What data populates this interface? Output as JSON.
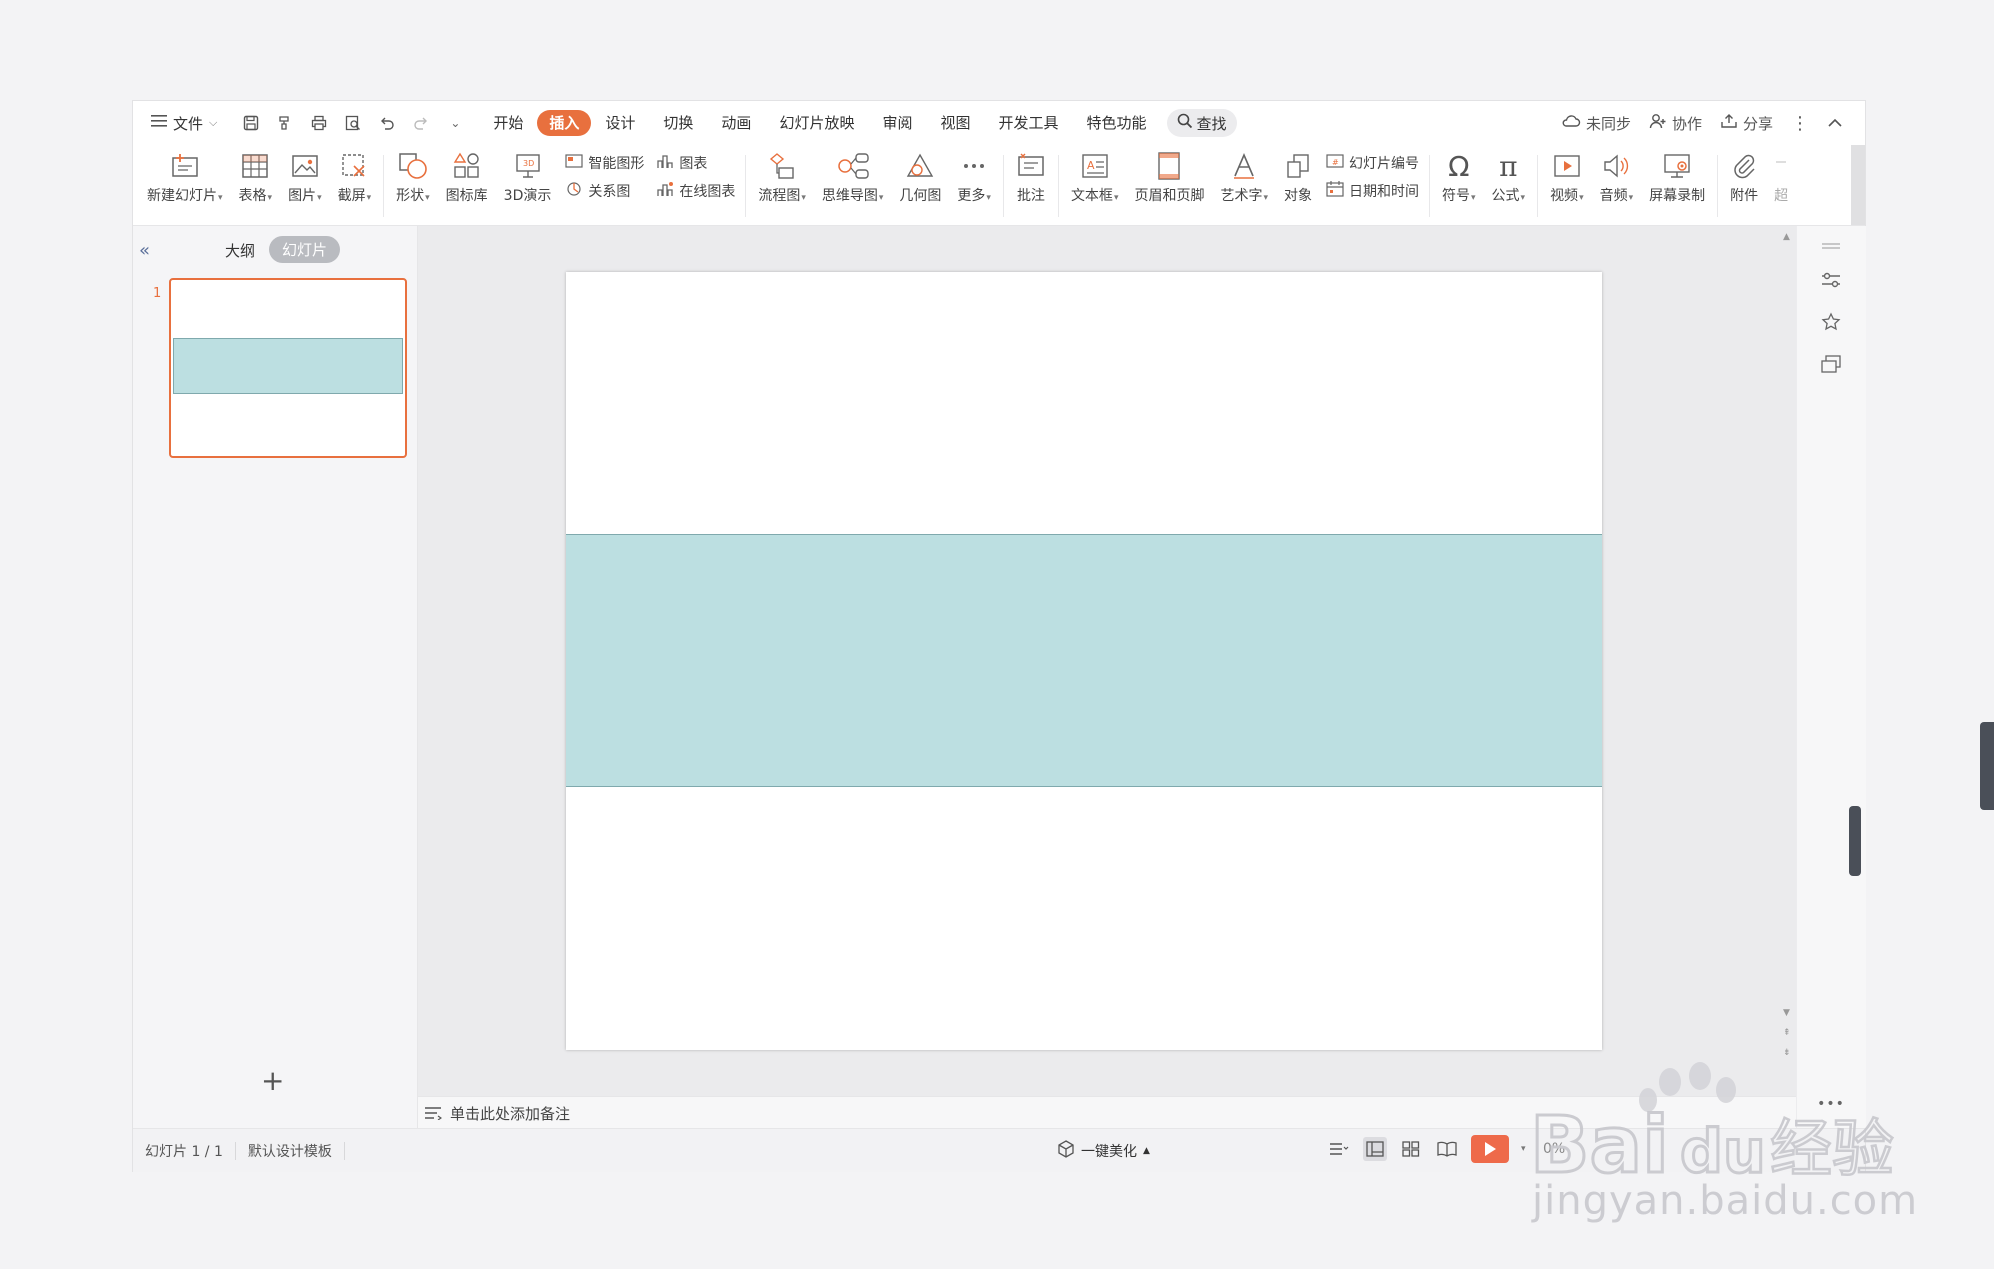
{
  "menubar": {
    "file_label": "文件",
    "tabs": [
      {
        "label": "开始"
      },
      {
        "label": "插入"
      },
      {
        "label": "设计"
      },
      {
        "label": "切换"
      },
      {
        "label": "动画"
      },
      {
        "label": "幻灯片放映"
      },
      {
        "label": "审阅"
      },
      {
        "label": "视图"
      },
      {
        "label": "开发工具"
      },
      {
        "label": "特色功能"
      }
    ],
    "active_tab": "插入",
    "search_label": "查找",
    "unsynced_label": "未同步",
    "collab_label": "协作",
    "share_label": "分享"
  },
  "ribbon": {
    "new_slide": "新建幻灯片",
    "table": "表格",
    "picture": "图片",
    "screenshot": "截屏",
    "shape": "形状",
    "icon_lib": "图标库",
    "demo3d": "3D演示",
    "smart_art": "智能图形",
    "chart": "图表",
    "relation": "关系图",
    "online_chart": "在线图表",
    "flowchart": "流程图",
    "mindmap": "思维导图",
    "geometry": "几何图",
    "more": "更多",
    "comment": "批注",
    "textbox": "文本框",
    "header_footer": "页眉和页脚",
    "wordart": "艺术字",
    "object": "对象",
    "slide_number": "幻灯片编号",
    "datetime": "日期和时间",
    "symbol": "符号",
    "formula": "公式",
    "video": "视频",
    "audio": "音频",
    "screen_record": "屏幕录制",
    "attachment": "附件",
    "hyperlink_partial": "超"
  },
  "left_pane": {
    "outline_label": "大纲",
    "slides_label": "幻灯片",
    "slide_number": "1",
    "add_label": "+"
  },
  "notes": {
    "placeholder": "单击此处添加备注"
  },
  "status": {
    "slide_info": "幻灯片 1 / 1",
    "template": "默认设计模板",
    "beautify": "一键美化",
    "zoom": "0%"
  },
  "colors": {
    "accent": "#e8703e",
    "band_fill": "#bcdfe1",
    "band_border": "#7fa9ad",
    "play": "#ee6a4a"
  },
  "watermark": {
    "brand": "Baidu经验",
    "url": "jingyan.baidu.com"
  }
}
